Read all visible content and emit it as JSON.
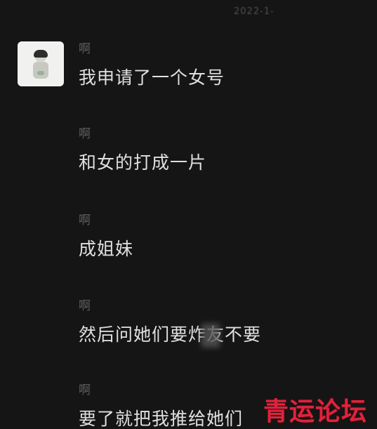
{
  "chat": {
    "timestamp": "2022-1-",
    "messages": [
      {
        "sender": "啊",
        "text": "我申请了一个女号"
      },
      {
        "sender": "啊",
        "text": "和女的打成一片"
      },
      {
        "sender": "啊",
        "text": "成姐妹"
      },
      {
        "sender": "啊",
        "text": "然后问她们要炸友不要"
      },
      {
        "sender": "啊",
        "text": "要了就把我推给她们"
      }
    ]
  },
  "watermark": {
    "text": "青运论坛",
    "color": "#e1223b"
  }
}
